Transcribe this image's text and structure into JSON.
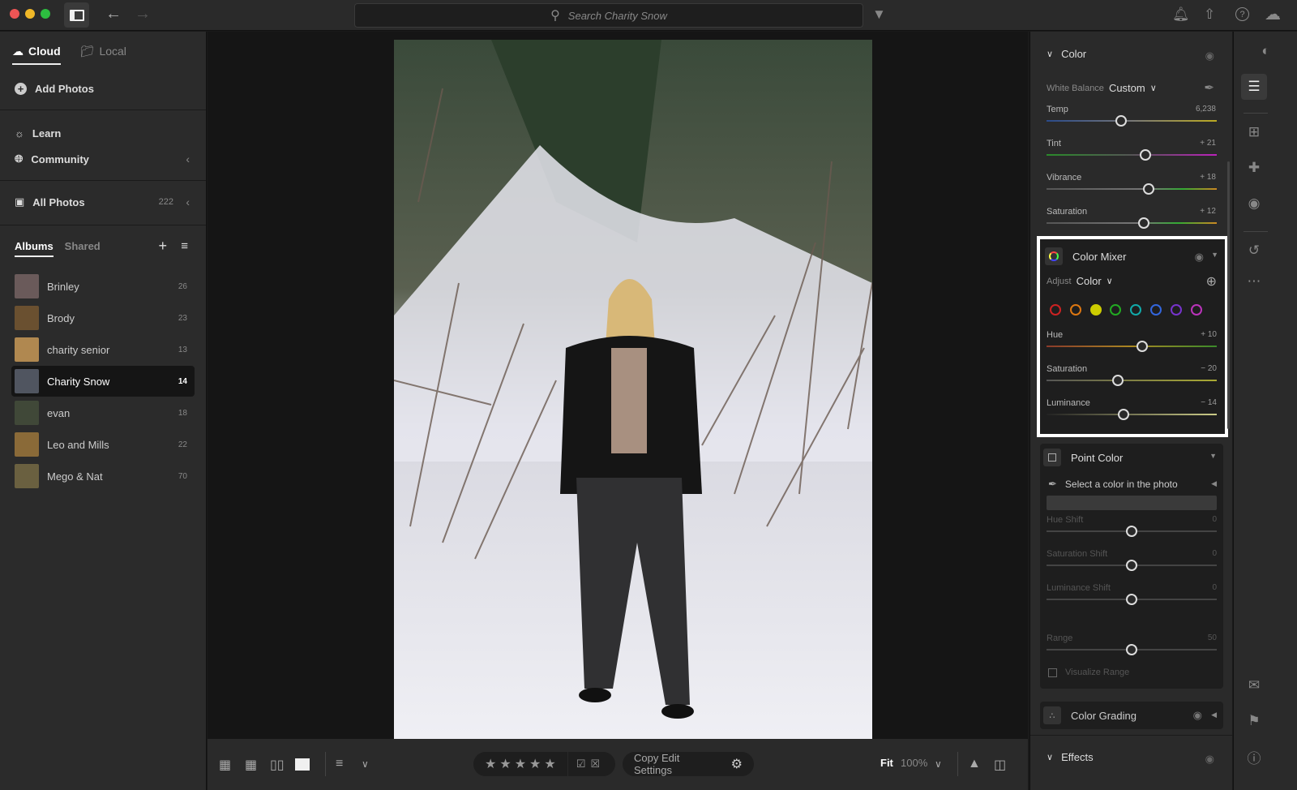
{
  "titlebar": {
    "search_placeholder": "Search Charity Snow",
    "icons": [
      "sidebar-toggle-icon",
      "back-arrow-icon",
      "forward-arrow-icon",
      "search-icon",
      "filter-icon",
      "bell-icon",
      "share-icon",
      "help-icon",
      "cloud-icon"
    ]
  },
  "left": {
    "tabs": [
      {
        "label": "Cloud",
        "active": true
      },
      {
        "label": "Local",
        "active": false
      }
    ],
    "add_photos": "Add Photos",
    "learn": "Learn",
    "community": "Community",
    "all_photos": {
      "label": "All Photos",
      "count": "222"
    },
    "album_tabs": [
      {
        "label": "Albums",
        "active": true
      },
      {
        "label": "Shared",
        "active": false
      }
    ],
    "albums": [
      {
        "name": "Brinley",
        "count": "26",
        "thumb": "#6a5a5a"
      },
      {
        "name": "Brody",
        "count": "23",
        "thumb": "#6a5030"
      },
      {
        "name": "charity senior",
        "count": "13",
        "thumb": "#b08850"
      },
      {
        "name": "Charity Snow",
        "count": "14",
        "thumb": "#505560",
        "selected": true
      },
      {
        "name": "evan",
        "count": "18",
        "thumb": "#404838"
      },
      {
        "name": "Leo and Mills",
        "count": "22",
        "thumb": "#8a6a38"
      },
      {
        "name": "Mego & Nat",
        "count": "70",
        "thumb": "#6a6040"
      }
    ]
  },
  "bottombar": {
    "copy_edit": "Copy Edit Settings",
    "fit": "Fit",
    "zoom": "100%",
    "rating_stars": 5
  },
  "right": {
    "color": {
      "title": "Color",
      "wb_label": "White Balance",
      "wb_value": "Custom",
      "sliders": [
        {
          "label": "Temp",
          "value": "6,238",
          "pos": 0.44
        },
        {
          "label": "Tint",
          "value": "+ 21",
          "pos": 0.58
        },
        {
          "label": "Vibrance",
          "value": "+ 18",
          "pos": 0.6
        },
        {
          "label": "Saturation",
          "value": "+ 12",
          "pos": 0.57
        }
      ]
    },
    "mixer": {
      "title": "Color Mixer",
      "adjust_label": "Adjust",
      "adjust_value": "Color",
      "swatches": [
        "#cc2222",
        "#dd7711",
        "#cccc00",
        "#22aa22",
        "#11aaaa",
        "#3366dd",
        "#7733cc",
        "#bb33bb"
      ],
      "selected_swatch": 2,
      "sliders": [
        {
          "label": "Hue",
          "value": "+ 10",
          "pos": 0.56
        },
        {
          "label": "Saturation",
          "value": "− 20",
          "pos": 0.42
        },
        {
          "label": "Luminance",
          "value": "− 14",
          "pos": 0.45
        }
      ]
    },
    "point": {
      "title": "Point Color",
      "select_text": "Select a color in the photo",
      "sliders": [
        {
          "label": "Hue Shift",
          "value": "0",
          "pos": 0.5
        },
        {
          "label": "Saturation Shift",
          "value": "0",
          "pos": 0.5
        },
        {
          "label": "Luminance Shift",
          "value": "0",
          "pos": 0.5
        },
        {
          "label": "Range",
          "value": "50",
          "pos": 0.5
        }
      ],
      "visualize": "Visualize Range"
    },
    "grading": {
      "title": "Color Grading"
    },
    "effects": {
      "title": "Effects"
    }
  }
}
